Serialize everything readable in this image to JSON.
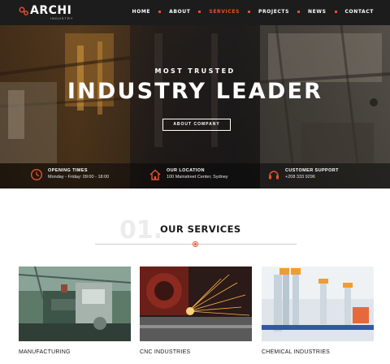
{
  "brand": {
    "name": "ARCHI",
    "tagline": "INDUSTRY",
    "accent": "#e8502b"
  },
  "nav": {
    "items": [
      {
        "label": "HOME",
        "active": false
      },
      {
        "label": "ABOUT",
        "active": false
      },
      {
        "label": "SERVICES",
        "active": true
      },
      {
        "label": "PROJECTS",
        "active": false
      },
      {
        "label": "NEWS",
        "active": false
      },
      {
        "label": "CONTACT",
        "active": false
      }
    ]
  },
  "hero": {
    "eyebrow": "MOST TRUSTED",
    "headline": "INDUSTRY LEADER",
    "button_label": "ABOUT COMPANY"
  },
  "info": [
    {
      "icon": "clock-icon",
      "title": "OPENING TIMES",
      "text": "Monday - Friday: 09:00 - 18:00"
    },
    {
      "icon": "home-icon",
      "title": "OUR LOCATION",
      "text": "100 Mainstreet Center, Sydney"
    },
    {
      "icon": "headset-icon",
      "title": "CUSTOMER SUPPORT",
      "text": "+208 333 9296"
    }
  ],
  "services": {
    "number": "01.",
    "title": "OUR SERVICES",
    "cards": [
      {
        "label": "MANUFACTURING",
        "image": "factory-machinery-image"
      },
      {
        "label": "CNC INDUSTRIES",
        "image": "metal-grinding-sparks-image"
      },
      {
        "label": "CHEMICAL INDUSTRIES",
        "image": "laboratory-test-tubes-image"
      }
    ]
  }
}
